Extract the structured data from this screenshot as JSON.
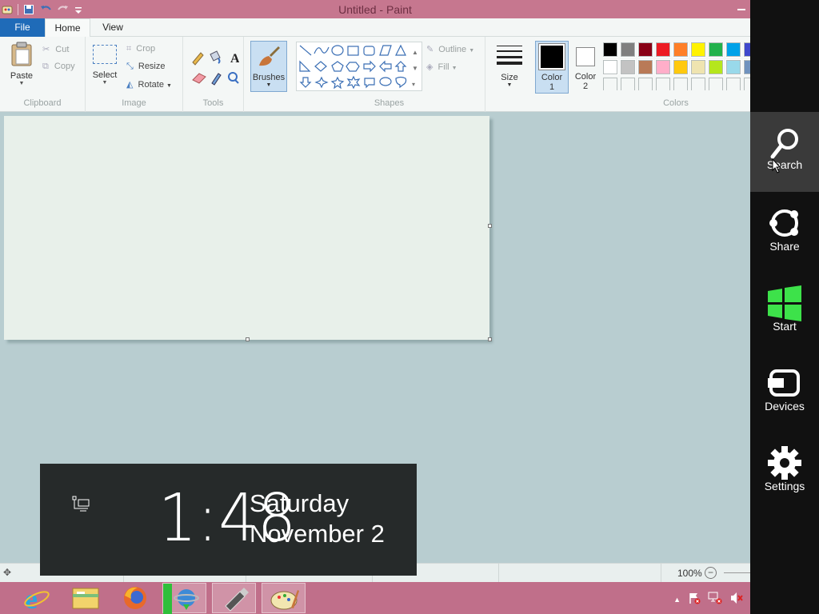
{
  "window": {
    "title": "Untitled - Paint"
  },
  "tabs": [
    {
      "label": "File"
    },
    {
      "label": "Home"
    },
    {
      "label": "View"
    }
  ],
  "ribbon": {
    "clipboard": {
      "label": "Clipboard",
      "paste": "Paste",
      "cut": "Cut",
      "copy": "Copy"
    },
    "image": {
      "label": "Image",
      "select": "Select",
      "crop": "Crop",
      "resize": "Resize",
      "rotate": "Rotate"
    },
    "tools": {
      "label": "Tools"
    },
    "brushes": {
      "label": "Brushes"
    },
    "shapes": {
      "label": "Shapes",
      "outline": "Outline",
      "fill": "Fill"
    },
    "size": {
      "label": "Size"
    },
    "color1": {
      "line1": "Color",
      "line2": "1"
    },
    "color2": {
      "line1": "Color",
      "line2": "2"
    },
    "colors": {
      "label": "Colors",
      "row1": [
        "#000000",
        "#7f7f7f",
        "#880015",
        "#ed1c24",
        "#ff7f27",
        "#fff200",
        "#22b14c",
        "#00a2e8",
        "#3f48cc"
      ],
      "row2": [
        "#ffffff",
        "#c3c3c3",
        "#b97a57",
        "#ffaec9",
        "#ffc90e",
        "#efe4b0",
        "#b5e61d",
        "#99d9ea",
        "#7092be"
      ]
    }
  },
  "status": {
    "zoom": "100%"
  },
  "charms": [
    {
      "label": "Search",
      "icon": "search-icon"
    },
    {
      "label": "Share",
      "icon": "share-icon"
    },
    {
      "label": "Start",
      "icon": "windows-logo-icon"
    },
    {
      "label": "Devices",
      "icon": "devices-icon"
    },
    {
      "label": "Settings",
      "icon": "settings-icon"
    }
  ],
  "clock": {
    "time": "1:48",
    "day": "Saturday",
    "date": "November 2"
  },
  "taskbar": {
    "items": [
      {
        "name": "internet-explorer-icon"
      },
      {
        "name": "file-explorer-icon"
      },
      {
        "name": "firefox-icon"
      },
      {
        "name": "download-manager-icon"
      },
      {
        "name": "usb-drive-icon"
      },
      {
        "name": "paint-icon"
      }
    ]
  }
}
